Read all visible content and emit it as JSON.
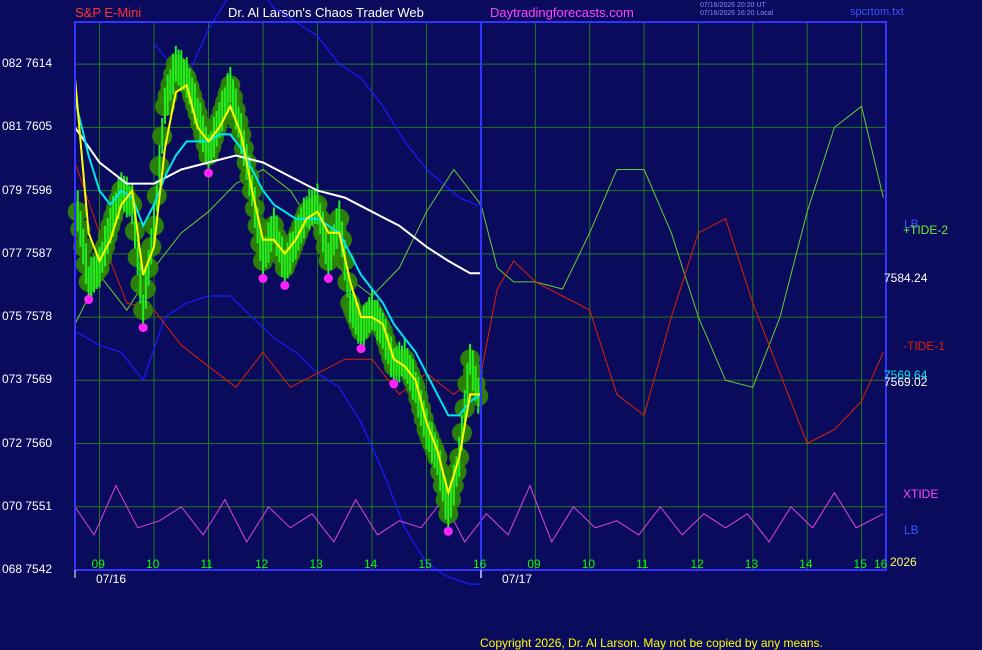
{
  "header": {
    "symbol": "S&P E-Mini",
    "site_title": "Dr. Al Larson's Chaos Trader Web",
    "site_url": "Daytradingforecasts.com",
    "time_line1": "07/16/2026 20:20 UT",
    "time_line2": "07/16/2026 16:20 Local",
    "file_name": "spcrtom.txt"
  },
  "colors": {
    "background": "#0b0b5e",
    "plot_border": "#3333ff",
    "grid": "#1f7a1f",
    "price_bars": "#22ee22",
    "price_glow": "#2e8b00",
    "fast_avg": "#ffff00",
    "mid_avg": "#00e5ee",
    "slow_avg": "#ffffff",
    "bands": "#1a1aff",
    "tide_plus": "#66cc33",
    "tide_minus": "#dd2200",
    "xtide": "#dd44dd",
    "markers": "#ff22ff"
  },
  "y_axis": [
    {
      "code": "082",
      "price": "7614"
    },
    {
      "code": "081",
      "price": "7605"
    },
    {
      "code": "079",
      "price": "7596"
    },
    {
      "code": "077",
      "price": "7587"
    },
    {
      "code": "075",
      "price": "7578"
    },
    {
      "code": "073",
      "price": "7569"
    },
    {
      "code": "072",
      "price": "7560"
    },
    {
      "code": "070",
      "price": "7551"
    },
    {
      "code": "068",
      "price": "7542"
    }
  ],
  "x_axis": {
    "hours": [
      "09",
      "10",
      "11",
      "12",
      "13",
      "14",
      "15",
      "16",
      "09",
      "10",
      "11",
      "12",
      "13",
      "14",
      "15",
      "16"
    ],
    "dates": [
      "07/16",
      "07/17"
    ],
    "year": "2026"
  },
  "right_labels": {
    "lb_top": "LB",
    "tide2": "+TIDE-2",
    "price_a": "7584.24",
    "tide1": "-TIDE-1",
    "price_b": "7569.64",
    "price_c": "7569.02",
    "xtide": "XTIDE",
    "lb_bottom": "LB"
  },
  "copyright": "Copyright 2026, Dr. Al Larson. May not be copied by any means.",
  "chart_data": {
    "type": "line",
    "title": "S&P E-Mini",
    "ylim": [
      7542,
      7620
    ],
    "grid": true,
    "y_ticks": [
      7542,
      7551,
      7560,
      7569,
      7578,
      7587,
      7596,
      7605,
      7614
    ],
    "series": [
      {
        "name": "S&P E-Mini price",
        "x": [
          8.6,
          8.8,
          9.0,
          9.2,
          9.4,
          9.6,
          9.8,
          10.0,
          10.2,
          10.4,
          10.6,
          10.8,
          11.0,
          11.2,
          11.4,
          11.6,
          11.8,
          12.0,
          12.2,
          12.4,
          12.6,
          12.8,
          13.0,
          13.2,
          13.4,
          13.6,
          13.8,
          14.0,
          14.2,
          14.4,
          14.6,
          14.8,
          15.0,
          15.2,
          15.4,
          15.6,
          15.8,
          16.0
        ],
        "y": [
          7593,
          7583,
          7585,
          7591,
          7596,
          7594,
          7579,
          7591,
          7608,
          7614,
          7612,
          7607,
          7601,
          7606,
          7611,
          7604,
          7596,
          7586,
          7591,
          7585,
          7589,
          7593,
          7594,
          7586,
          7592,
          7580,
          7576,
          7579,
          7576,
          7571,
          7572,
          7568,
          7562,
          7558,
          7550,
          7558,
          7572,
          7565
        ]
      },
      {
        "name": "fast average",
        "x": [
          8.55,
          8.8,
          9.0,
          9.2,
          9.4,
          9.6,
          9.8,
          10.0,
          10.2,
          10.4,
          10.6,
          10.8,
          11.0,
          11.2,
          11.4,
          11.6,
          11.8,
          12.0,
          12.2,
          12.4,
          12.6,
          12.8,
          13.0,
          13.2,
          13.4,
          13.6,
          13.8,
          14.0,
          14.2,
          14.4,
          14.6,
          14.8,
          15.0,
          15.2,
          15.4,
          15.6,
          15.8,
          16.0
        ],
        "y": [
          7612,
          7590,
          7586,
          7589,
          7594,
          7596,
          7584,
          7588,
          7602,
          7610,
          7611,
          7605,
          7603,
          7605,
          7608,
          7604,
          7596,
          7589,
          7589,
          7587,
          7589,
          7592,
          7593,
          7590,
          7590,
          7583,
          7578,
          7578,
          7577,
          7572,
          7571,
          7569,
          7563,
          7559,
          7553,
          7558,
          7567,
          7567
        ]
      },
      {
        "name": "mid average",
        "x": [
          8.55,
          8.8,
          9.0,
          9.2,
          9.4,
          9.6,
          9.8,
          10.0,
          10.2,
          10.4,
          10.6,
          10.8,
          11.0,
          11.2,
          11.4,
          11.6,
          11.8,
          12.0,
          12.2,
          12.4,
          12.6,
          12.8,
          13.0,
          13.2,
          13.4,
          13.6,
          13.8,
          14.0,
          14.2,
          14.4,
          14.6,
          14.8,
          15.0,
          15.2,
          15.4,
          15.6,
          15.8,
          16.0
        ],
        "y": [
          7609,
          7601,
          7596,
          7594,
          7596,
          7595,
          7591,
          7594,
          7598,
          7601,
          7603,
          7603,
          7603,
          7604,
          7604,
          7602,
          7599,
          7596,
          7594,
          7593,
          7592,
          7592,
          7592,
          7591,
          7590,
          7587,
          7584,
          7582,
          7580,
          7577,
          7575,
          7573,
          7570,
          7567,
          7564,
          7564,
          7566,
          7567
        ]
      },
      {
        "name": "slow average",
        "x": [
          8.55,
          9.0,
          9.5,
          10.0,
          10.5,
          11.0,
          11.5,
          12.0,
          12.5,
          13.0,
          13.5,
          14.0,
          14.5,
          15.0,
          15.4,
          15.8,
          16.0
        ],
        "y": [
          7605,
          7600,
          7597,
          7597,
          7599,
          7600,
          7601,
          7600,
          7598,
          7596,
          7595,
          7593,
          7591,
          7588,
          7586,
          7584.24,
          7584.24
        ]
      },
      {
        "name": "+TIDE-2",
        "x": [
          8.55,
          9.0,
          9.5,
          10.0,
          10.5,
          11.0,
          11.5,
          12.0,
          12.5,
          13.0,
          13.5,
          14.0,
          14.5,
          15.0,
          15.5,
          16.0,
          16.3,
          16.6,
          17.0,
          17.5,
          18.0,
          18.5,
          19.0,
          19.5,
          20.0,
          20.5,
          21.0,
          21.5,
          22.0,
          22.5,
          23.0,
          23.4
        ],
        "y": [
          7577,
          7584,
          7579,
          7585,
          7590,
          7593,
          7597,
          7599,
          7596,
          7590,
          7584,
          7581,
          7585,
          7593,
          7599,
          7594,
          7585,
          7583,
          7583,
          7582,
          7590,
          7599,
          7599,
          7590,
          7578,
          7569,
          7568,
          7578,
          7593,
          7605,
          7608,
          7595
        ]
      },
      {
        "name": "-TIDE-1",
        "x": [
          8.55,
          9.0,
          9.5,
          10.0,
          10.5,
          11.0,
          11.5,
          12.0,
          12.5,
          13.0,
          13.5,
          14.0,
          14.5,
          15.0,
          15.5,
          16.0,
          16.3,
          16.6,
          17.0,
          17.5,
          18.0,
          18.5,
          19.0,
          19.5,
          20.0,
          20.5,
          21.0,
          21.5,
          22.0,
          22.5,
          23.0,
          23.4
        ],
        "y": [
          7600,
          7590,
          7580,
          7579,
          7574,
          7571,
          7568,
          7573,
          7568,
          7570,
          7572,
          7572,
          7567,
          7570,
          7567,
          7570,
          7582,
          7586,
          7583,
          7581,
          7579,
          7567,
          7564,
          7578,
          7590,
          7592,
          7580,
          7570,
          7560,
          7562,
          7566,
          7573
        ]
      },
      {
        "name": "XTIDE",
        "x": [
          8.55,
          8.9,
          9.3,
          9.7,
          10.1,
          10.5,
          10.9,
          11.3,
          11.7,
          12.1,
          12.5,
          12.9,
          13.3,
          13.7,
          14.1,
          14.5,
          14.9,
          15.3,
          15.7,
          16.1,
          16.5,
          16.9,
          17.3,
          17.7,
          18.1,
          18.5,
          18.9,
          19.3,
          19.7,
          20.1,
          20.5,
          20.9,
          21.3,
          21.7,
          22.1,
          22.5,
          22.9,
          23.4
        ],
        "y": [
          7551,
          7547,
          7554,
          7548,
          7549,
          7551,
          7547,
          7552,
          7546,
          7551,
          7548,
          7550,
          7546,
          7552,
          7547,
          7549,
          7548,
          7552,
          7546,
          7550,
          7547,
          7554,
          7546,
          7551,
          7548,
          7549,
          7547,
          7551,
          7547,
          7550,
          7548,
          7550,
          7546,
          7551,
          7548,
          7553,
          7548,
          7550
        ]
      },
      {
        "name": "upper band",
        "x": [
          10.0,
          10.3,
          10.6,
          11.0,
          11.4,
          11.8,
          12.2,
          12.6,
          13.0,
          13.4,
          13.8,
          14.2,
          14.6,
          15.0,
          15.3,
          15.6,
          15.9,
          16.0
        ],
        "y": [
          7617,
          7614,
          7612,
          7619,
          7624,
          7626,
          7622,
          7620,
          7618,
          7614,
          7612,
          7608,
          7603,
          7599,
          7597,
          7595,
          7594,
          7594
        ]
      },
      {
        "name": "lower band",
        "x": [
          8.55,
          9.0,
          9.4,
          9.8,
          10.2,
          10.6,
          11.0,
          11.4,
          11.8,
          12.2,
          12.6,
          13.0,
          13.4,
          13.8,
          14.2,
          14.6,
          15.0,
          15.4,
          15.8,
          16.0
        ],
        "y": [
          7576,
          7574,
          7573,
          7569,
          7578,
          7580,
          7581,
          7581,
          7578,
          7575,
          7573,
          7570,
          7568,
          7563,
          7556,
          7548,
          7543,
          7541,
          7540,
          7540
        ]
      }
    ]
  }
}
